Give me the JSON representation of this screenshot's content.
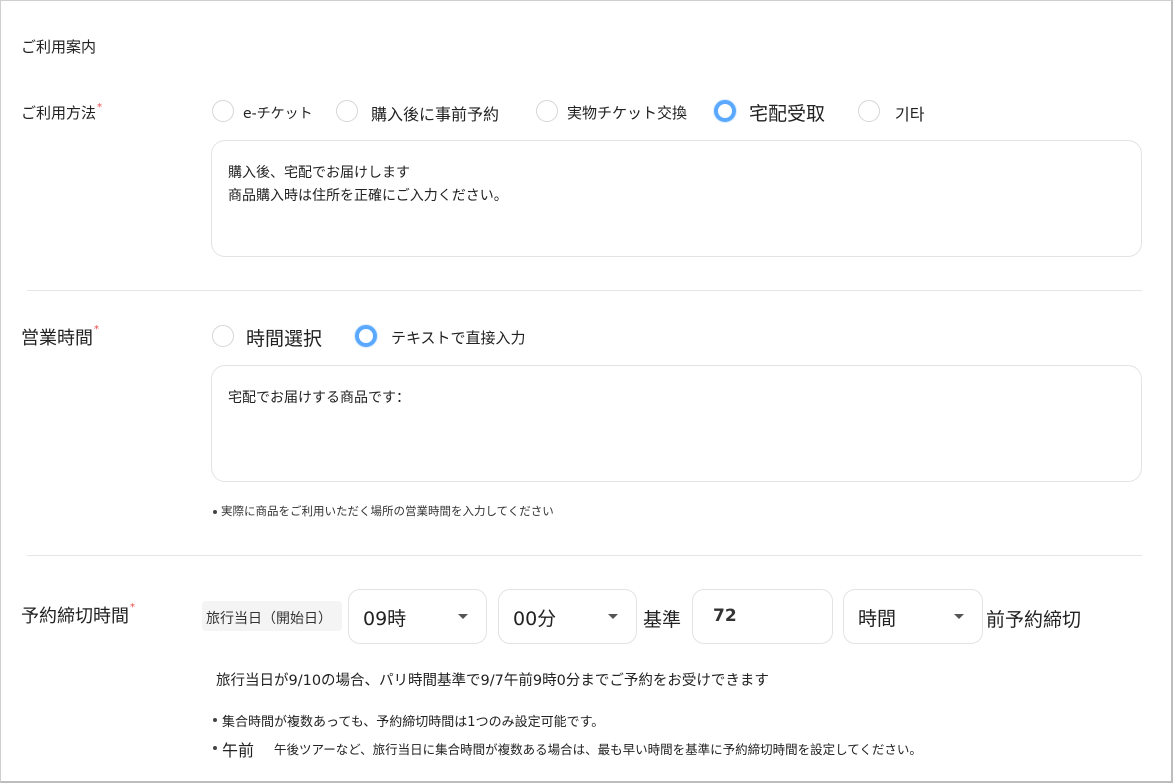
{
  "section_title": "ご利用案内",
  "usage": {
    "label": "ご利用方法",
    "options": [
      "e-チケット",
      "購入後に事前予約",
      "実物チケット交換",
      "宅配受取",
      "기타"
    ],
    "selected": "宅配受取",
    "text_line1": "購入後、宅配でお届けします",
    "text_line2": "商品購入時は住所を正確にご入力ください。"
  },
  "hours": {
    "label": "営業時間",
    "options": [
      "時間選択",
      "テキストで直接入力"
    ],
    "selected": "テキストで直接入力",
    "text": "宅配でお届けする商品です：",
    "note": "実際に商品をご利用いただく場所の営業時間を入力してください"
  },
  "deadline": {
    "label": "予約締切時間",
    "base_label": "旅行当日（開始日）",
    "hour_value": "09時",
    "minute_value": "00分",
    "kijun": "基準",
    "amount": "72",
    "unit_value": "時間",
    "suffix": "前予約締切",
    "example": "旅行当日が9/10の場合、パリ時間基準で9/7午前9時0分までご予約をお受けできます",
    "note1": "集合時間が複数あっても、予約締切時間は1つのみ設定可能です。",
    "note2_prefix": "午前",
    "note2": "午後ツアーなど、旅行当日に集合時間が複数ある場合は、最も早い時間を基準に予約締切時間を設定してください。"
  },
  "colors": {
    "accent": "#5aa9ff",
    "required": "#e84a4a",
    "border": "#e3e3e3"
  }
}
